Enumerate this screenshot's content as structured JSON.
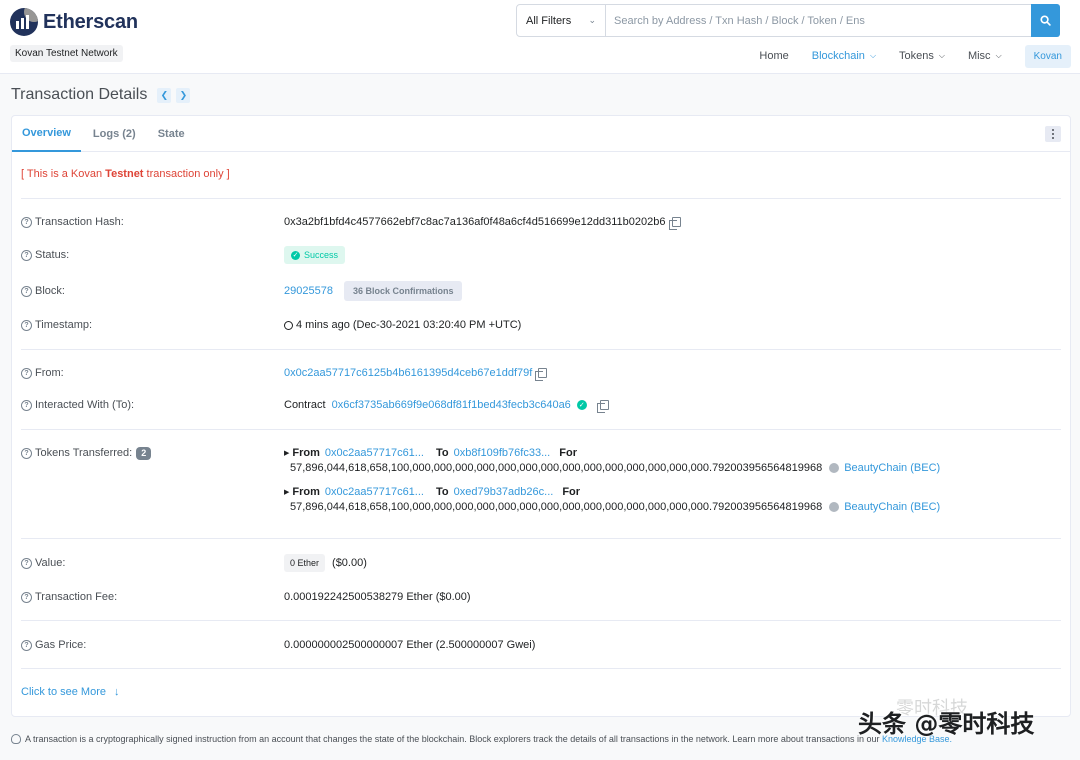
{
  "brand": {
    "name": "Etherscan",
    "network": "Kovan Testnet Network"
  },
  "search": {
    "filter": "All Filters",
    "placeholder": "Search by Address / Txn Hash / Block / Token / Ens"
  },
  "nav": {
    "home": "Home",
    "blockchain": "Blockchain",
    "tokens": "Tokens",
    "misc": "Misc",
    "network_button": "Kovan"
  },
  "page": {
    "title": "Transaction Details"
  },
  "tabs": [
    "Overview",
    "Logs (2)",
    "State"
  ],
  "warning": {
    "prefix": "[ This is a Kovan ",
    "bold": "Testnet",
    "suffix": " transaction only ]"
  },
  "details": {
    "tx_hash": {
      "label": "Transaction Hash:",
      "value": "0x3a2bf1bfd4c4577662ebf7c8ac7a136af0f48a6cf4d516699e12dd311b0202b6"
    },
    "status": {
      "label": "Status:",
      "value": "Success"
    },
    "block": {
      "label": "Block:",
      "value": "29025578",
      "confirmations": "36 Block Confirmations"
    },
    "timestamp": {
      "label": "Timestamp:",
      "value": "4 mins ago (Dec-30-2021 03:20:40 PM +UTC)"
    },
    "from": {
      "label": "From:",
      "value": "0x0c2aa57717c6125b4b6161395d4ceb67e1ddf79f"
    },
    "to": {
      "label": "Interacted With (To):",
      "prefix": "Contract ",
      "value": "0x6cf3735ab669f9e068df81f1bed43fecb3c640a6"
    },
    "tokens": {
      "label": "Tokens Transferred:",
      "count": "2",
      "transfers": [
        {
          "from_kw": "From",
          "from": "0x0c2aa57717c61...",
          "to_kw": "To",
          "to": "0xb8f109fb76fc33...",
          "for_kw": "For",
          "amount": "57,896,044,618,658,100,000,000,000,000,000,000,000,000,000,000,000,000,000,000.792003956564819968",
          "token": "BeautyChain (BEC)"
        },
        {
          "from_kw": "From",
          "from": "0x0c2aa57717c61...",
          "to_kw": "To",
          "to": "0xed79b37adb26c...",
          "for_kw": "For",
          "amount": "57,896,044,618,658,100,000,000,000,000,000,000,000,000,000,000,000,000,000,000.792003956564819968",
          "token": "BeautyChain (BEC)"
        }
      ]
    },
    "value": {
      "label": "Value:",
      "badge": "0 Ether",
      "usd": "($0.00)"
    },
    "fee": {
      "label": "Transaction Fee:",
      "value": "0.000192242500538279 Ether ($0.00)"
    },
    "gas_price": {
      "label": "Gas Price:",
      "value": "0.000000002500000007 Ether (2.500000007 Gwei)"
    }
  },
  "more": {
    "label": "Click to see More"
  },
  "footer": {
    "note": "A transaction is a cryptographically signed instruction from an account that changes the state of the blockchain. Block explorers track the details of all transactions in the network. Learn more about transactions in our ",
    "link": "Knowledge Base."
  },
  "watermark": {
    "text": "头条 @零时科技",
    "faint": "零时科技"
  },
  "colors": {
    "accent": "#3498db",
    "success": "#00c9a7",
    "danger": "#de4437",
    "brand": "#21325b"
  },
  "icons": {
    "search": "search-icon",
    "copy": "copy-icon",
    "help": "question-circle-icon",
    "clock": "clock-icon",
    "verified": "check-circle-icon",
    "token": "ether-token-icon",
    "bulb": "lightbulb-icon"
  }
}
